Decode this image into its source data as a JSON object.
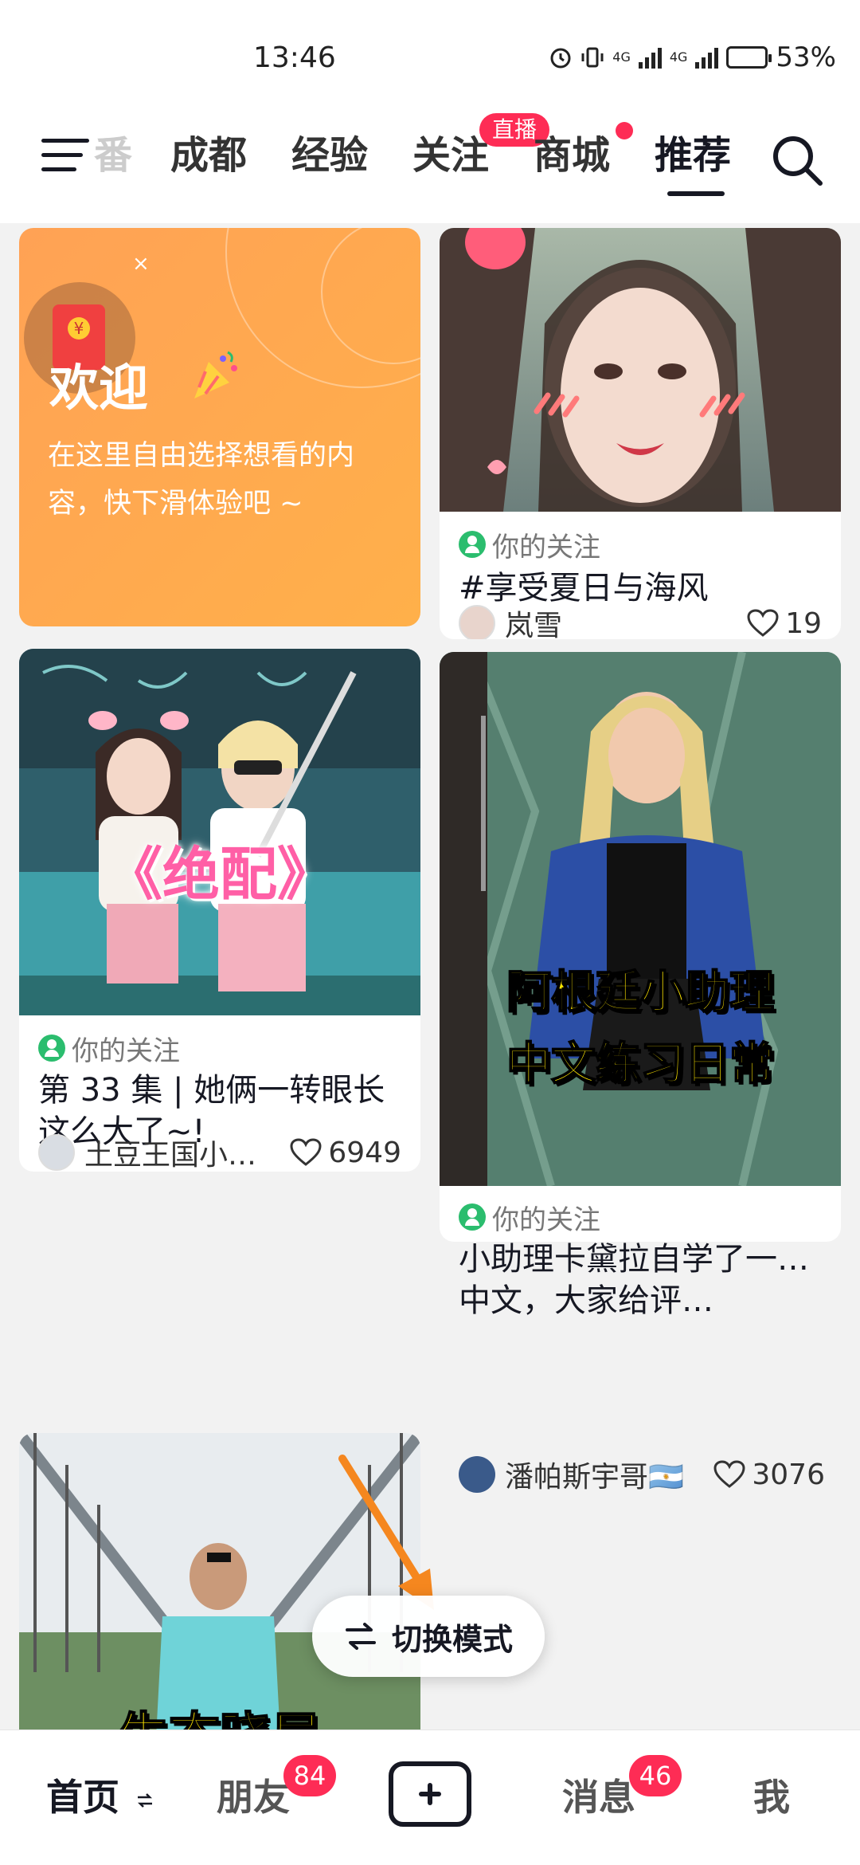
{
  "status_bar": {
    "time": "13:46",
    "network_1": "4G",
    "network_2": "4G",
    "battery_percent": "53%",
    "battery_level": 0.53
  },
  "top_nav": {
    "tabs": [
      {
        "label": "番"
      },
      {
        "label": "成都"
      },
      {
        "label": "经验"
      },
      {
        "label": "关注"
      },
      {
        "label": "商城"
      },
      {
        "label": "推荐"
      }
    ],
    "active_tab": "推荐",
    "live_badge": "直播"
  },
  "welcome_card": {
    "title": "欢迎",
    "description": "在这里自由选择想看的内容，快下滑体验吧 ~",
    "close_label": "×"
  },
  "cards": [
    {
      "follow_label": "你的关注",
      "title": "#享受夏日与海风",
      "author": "岚雪",
      "likes": "19"
    },
    {
      "cover_text": "《绝配》",
      "follow_label": "你的关注",
      "title": "第 33 集 | 她俩一转眼长这么大了~!",
      "author": "土豆王国小…",
      "likes": "6949"
    },
    {
      "cover_caption_1": "阿根廷小助理",
      "cover_caption_2": "中文练习日常",
      "follow_label": "你的关注",
      "title": "小助理卡黛拉自学了一…中文，大家给评…",
      "author": "潘帕斯宇哥🇦🇷",
      "likes": "3076"
    },
    {
      "cover_caption_1": "生态晓局"
    }
  ],
  "switch_mode": {
    "label": "切换模式"
  },
  "bottom_nav": {
    "home": "首页",
    "friends": "朋友",
    "friends_badge": "84",
    "messages": "消息",
    "messages_badge": "46",
    "me": "我"
  },
  "colors": {
    "accent_red": "#fe2c55",
    "follow_green": "#2bbd6e",
    "welcome_orange": "#ffa255",
    "annotation_arrow": "#f5871f"
  }
}
